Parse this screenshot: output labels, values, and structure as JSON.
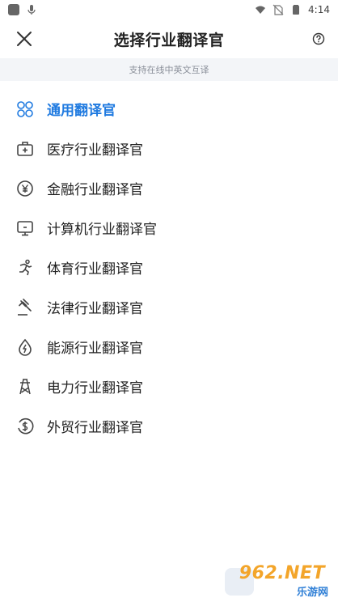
{
  "status_bar": {
    "time": "4:14",
    "icons": [
      "square-app-icon",
      "mic-icon",
      "wifi-icon",
      "no-sim-icon",
      "battery-icon"
    ]
  },
  "app_bar": {
    "title": "选择行业翻译官",
    "close_icon": "close-icon",
    "help_icon": "help-icon"
  },
  "subtitle": "支持在线中英文互译",
  "list": {
    "active_color": "#1f7ae0",
    "items": [
      {
        "label": "通用翻译官",
        "icon": "grid-icon",
        "active": true
      },
      {
        "label": "医疗行业翻译官",
        "icon": "medical-kit-icon",
        "active": false
      },
      {
        "label": "金融行业翻译官",
        "icon": "yen-icon",
        "active": false
      },
      {
        "label": "计算机行业翻译官",
        "icon": "monitor-icon",
        "active": false
      },
      {
        "label": "体育行业翻译官",
        "icon": "runner-icon",
        "active": false
      },
      {
        "label": "法律行业翻译官",
        "icon": "gavel-icon",
        "active": false
      },
      {
        "label": "能源行业翻译官",
        "icon": "energy-drop-icon",
        "active": false
      },
      {
        "label": "电力行业翻译官",
        "icon": "power-tower-icon",
        "active": false
      },
      {
        "label": "外贸行业翻译官",
        "icon": "dollar-coin-icon",
        "active": false
      }
    ]
  },
  "watermark": {
    "main": "962.NET",
    "sub": "乐游网"
  }
}
